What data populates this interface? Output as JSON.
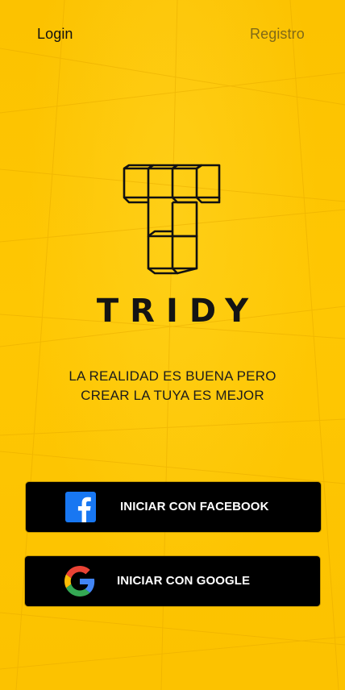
{
  "nav": {
    "login_label": "Login",
    "register_label": "Registro"
  },
  "brand": {
    "name": "TRIDY",
    "logo_icon": "tridy-cube-t-logo-icon"
  },
  "tagline": {
    "line1": "LA REALIDAD ES BUENA PERO",
    "line2": "CREAR LA TUYA ES MEJOR"
  },
  "buttons": {
    "facebook": {
      "label": "INICIAR CON FACEBOOK",
      "icon": "facebook-icon",
      "icon_color": "#1877f2"
    },
    "google": {
      "label": "INICIAR CON GOOGLE",
      "icon": "google-icon"
    }
  },
  "colors": {
    "background": "#fdc402",
    "button_background": "#000000",
    "button_text": "#ffffff"
  }
}
